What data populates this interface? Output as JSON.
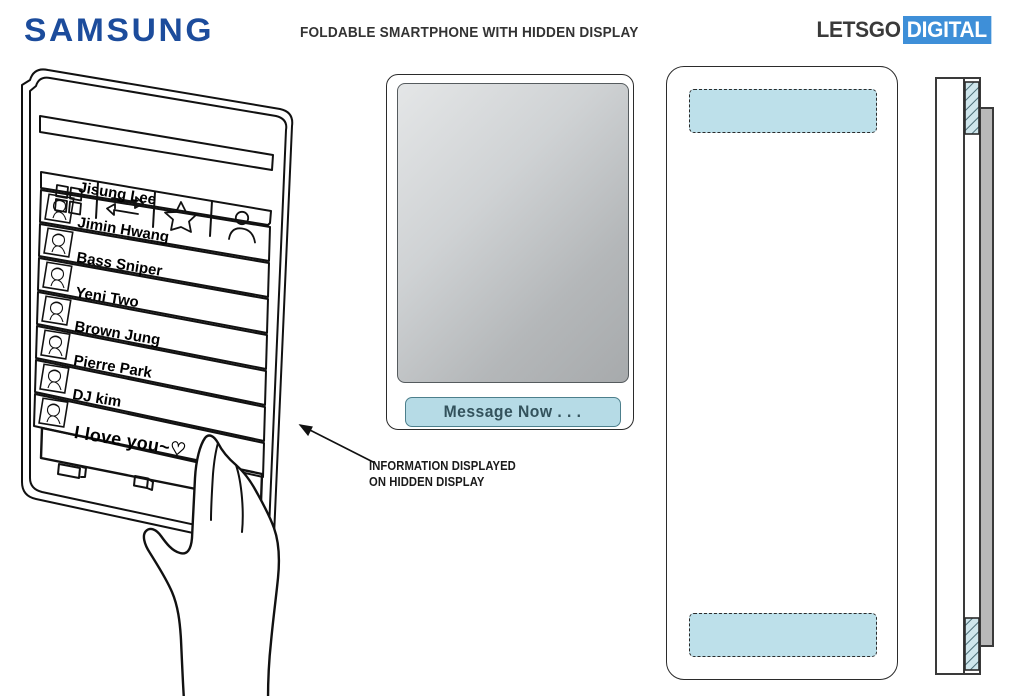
{
  "header": {
    "brand": "SAMSUNG",
    "title": "FOLDABLE SMARTPHONE WITH HIDDEN DISPLAY",
    "site_logo_part1": "LETSGO",
    "site_logo_part2": "DIGITAL",
    "brand_color": "#1c4c9c",
    "site_accent_color": "#3e8fd8"
  },
  "figure1": {
    "label": "foldable-phone-contact-list",
    "tabs": [
      {
        "name": "grid-tab",
        "icon": "grid-icon"
      },
      {
        "name": "transfer-tab",
        "icon": "swap-arrows-icon"
      },
      {
        "name": "favorites-tab",
        "icon": "star-icon"
      },
      {
        "name": "contacts-tab",
        "icon": "person-icon"
      }
    ],
    "contacts": [
      {
        "name": "Jisung Lee"
      },
      {
        "name": "Jimin Hwang"
      },
      {
        "name": "Bass Sniper"
      },
      {
        "name": "Yeni Two"
      },
      {
        "name": "Brown Jung"
      },
      {
        "name": "Pierre Park"
      },
      {
        "name": "DJ kim"
      }
    ],
    "message_preview": "I love you~♡",
    "navbar": [
      {
        "name": "recents-button",
        "icon": "recents-icon"
      },
      {
        "name": "home-button",
        "icon": "home-icon"
      },
      {
        "name": "back-button",
        "icon": "back-arrow-icon"
      }
    ],
    "hand": {
      "name": "pointing-hand",
      "gesture": "index-finger-touch"
    }
  },
  "figure2": {
    "label": "hidden-display-detail",
    "screen_fill": "gradient-gray",
    "message_bar_text": "Message Now . . .",
    "message_bar_color": "#b6dbe6",
    "message_bar_text_color": "#33525c"
  },
  "annotation": {
    "line1": "INFORMATION DISPLAYED",
    "line2": "ON HIDDEN DISPLAY"
  },
  "figure3": {
    "label": "front-view-hidden-zones",
    "zones": [
      {
        "name": "hidden-display-zone-top",
        "fill": "#bde0ea",
        "border": "dashed"
      },
      {
        "name": "hidden-display-zone-bottom",
        "fill": "#bde0ea",
        "border": "dashed"
      }
    ]
  },
  "figure4": {
    "label": "side-cross-section-view",
    "hatched_regions": [
      {
        "name": "hidden-display-layer-top"
      },
      {
        "name": "hidden-display-layer-bottom"
      }
    ]
  }
}
